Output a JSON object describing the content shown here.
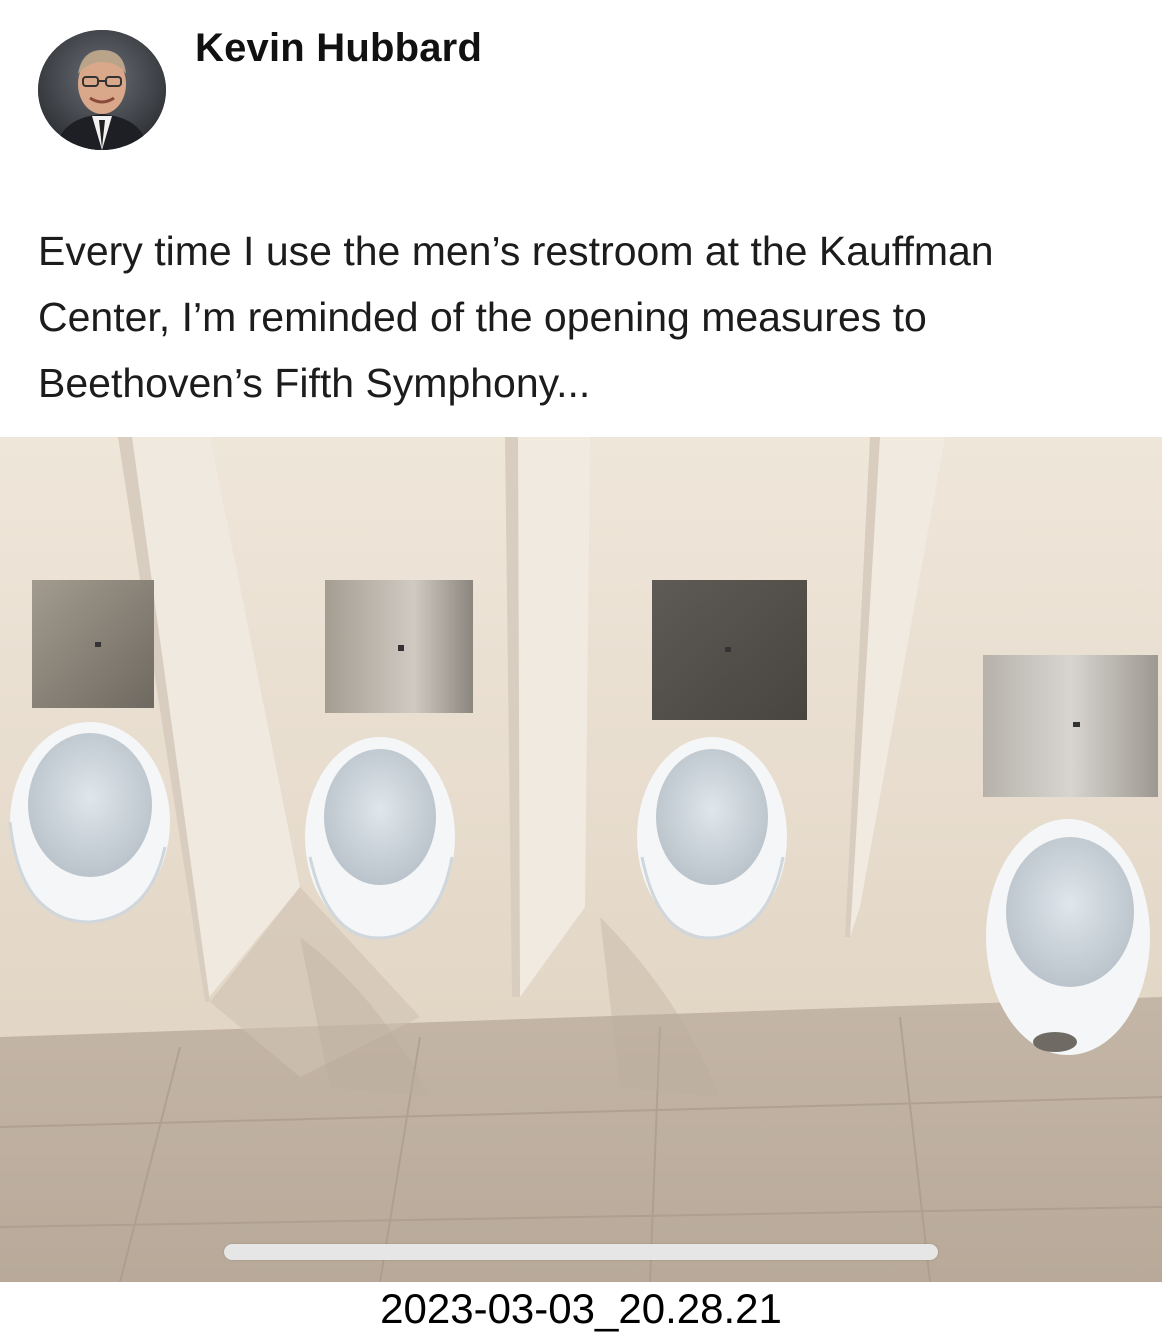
{
  "post": {
    "author": "Kevin Hubbard",
    "text": "Every time I use the men’s restroom at the Kauffman Center, I’m reminded of the opening measures to Beethoven’s Fifth Symphony..."
  },
  "footer": {
    "timestamp": "2023-03-03_20.28.21"
  },
  "colors": {
    "wall": "#e8dccb",
    "partition": "#efe7dc",
    "floor": "#b9aa9b",
    "urinal": "#f4f6f8",
    "panel_steel": "#9c978f",
    "panel_dark": "#55524e"
  },
  "icons": [
    "profile-avatar"
  ]
}
